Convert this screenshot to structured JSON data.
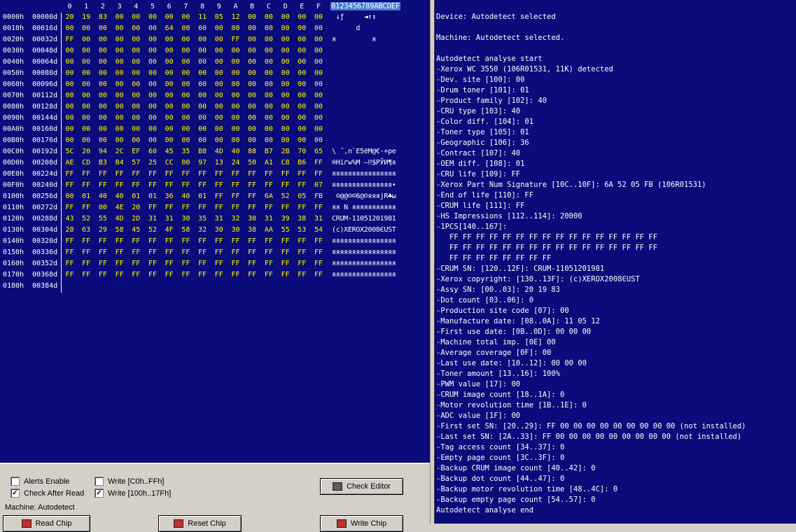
{
  "hex_view": {
    "column_headers": [
      "0",
      "1",
      "2",
      "3",
      "4",
      "5",
      "6",
      "7",
      "8",
      "9",
      "A",
      "B",
      "C",
      "D",
      "E",
      "F"
    ],
    "ascii_header": "0123456789ABCDEF",
    "rows": [
      {
        "addr": "0000h",
        "off": "00000d",
        "bytes": "20 19 83 00 00 00 00 00 11 05 12 00 00 00 00 00",
        "ascii": " ↓ƒ     ◄↑↕"
      },
      {
        "addr": "0010h",
        "off": "00016d",
        "bytes": "00 00 00 00 00 00 64 00 00 00 00 00 00 00 00 00",
        "ascii": "      d"
      },
      {
        "addr": "0020h",
        "off": "00032d",
        "bytes": "FF 00 00 00 00 00 00 00 00 00 FF 00 00 00 00 00",
        "ascii": "я         я"
      },
      {
        "addr": "0030h",
        "off": "00048d",
        "bytes": "00 00 00 00 00 00 00 00 00 00 00 00 00 00 00 00",
        "ascii": ""
      },
      {
        "addr": "0040h",
        "off": "00064d",
        "bytes": "00 00 00 00 00 00 00 00 00 00 00 00 00 00 00 00",
        "ascii": ""
      },
      {
        "addr": "0050h",
        "off": "00080d",
        "bytes": "00 00 00 00 00 00 00 00 00 00 00 00 00 00 00 00",
        "ascii": ""
      },
      {
        "addr": "0060h",
        "off": "00096d",
        "bytes": "00 00 00 00 00 00 00 00 00 00 00 00 00 00 00 00",
        "ascii": ""
      },
      {
        "addr": "0070h",
        "off": "00112d",
        "bytes": "00 00 00 00 00 00 00 00 00 00 00 00 00 00 00 00",
        "ascii": ""
      },
      {
        "addr": "0080h",
        "off": "00128d",
        "bytes": "00 00 00 00 00 00 00 00 00 00 00 00 00 00 00 00",
        "ascii": ""
      },
      {
        "addr": "0090h",
        "off": "00144d",
        "bytes": "00 00 00 00 00 00 00 00 00 00 00 00 00 00 00 00",
        "ascii": ""
      },
      {
        "addr": "00A0h",
        "off": "00160d",
        "bytes": "00 00 00 00 00 00 00 00 00 00 00 00 00 00 00 00",
        "ascii": ""
      },
      {
        "addr": "00B0h",
        "off": "00176d",
        "bytes": "00 00 00 00 00 00 00 00 00 00 00 00 00 00 00 00",
        "ascii": ""
      },
      {
        "addr": "00C0h",
        "off": "00192d",
        "bytes": "5C 20 94 2C EF 60 45 35 B8 4D 40 88 B7 2B 70 65",
        "ascii": "\\ ˝,п`E5ёM@€·+pe"
      },
      {
        "addr": "00D0h",
        "off": "00208d",
        "bytes": "AE CD B3 B4 57 25 CC 00 97 13 24 50 A1 C8 B6 FF",
        "ascii": "®Hiґw%M —‼$PЎИ¶я"
      },
      {
        "addr": "00E0h",
        "off": "00224d",
        "bytes": "FF FF FF FF FF FF FF FF FF FF FF FF FF FF FF FF",
        "ascii": "яяяяяяяяяяяяяяяя"
      },
      {
        "addr": "00F0h",
        "off": "00240d",
        "bytes": "FF FF FF FF FF FF FF FF FF FF FF FF FF FF FF 07",
        "ascii": "яяяяяяяяяяяяяяя•"
      },
      {
        "addr": "0100h",
        "off": "00256d",
        "bytes": "00 01 40 40 01 01 36 40 01 FF FF FF 6A 52 05 FB",
        "ascii": " ☺@@☺☺6@☺яяяjR♣ы"
      },
      {
        "addr": "0110h",
        "off": "00272d",
        "bytes": "FF FF 00 4E 20 FF FF FF FF FF FF FF FF FF FF FF",
        "ascii": "яя N яяяяяяяяяяя"
      },
      {
        "addr": "0120h",
        "off": "00288d",
        "bytes": "43 52 55 4D 2D 31 31 30 35 31 32 30 31 39 38 31",
        "ascii": "CRUM-11051201981"
      },
      {
        "addr": "0130h",
        "off": "00304d",
        "bytes": "28 63 29 58 45 52 4F 58 32 30 30 38 AA 55 53 54",
        "ascii": "(c)XEROX2008ЄUST"
      },
      {
        "addr": "0140h",
        "off": "00320d",
        "bytes": "FF FF FF FF FF FF FF FF FF FF FF FF FF FF FF FF",
        "ascii": "яяяяяяяяяяяяяяяя"
      },
      {
        "addr": "0150h",
        "off": "00336d",
        "bytes": "FF FF FF FF FF FF FF FF FF FF FF FF FF FF FF FF",
        "ascii": "яяяяяяяяяяяяяяяя"
      },
      {
        "addr": "0160h",
        "off": "00352d",
        "bytes": "FF FF FF FF FF FF FF FF FF FF FF FF FF FF FF FF",
        "ascii": "яяяяяяяяяяяяяяяя"
      },
      {
        "addr": "0170h",
        "off": "00368d",
        "bytes": "FF FF FF FF FF FF FF FF FF FF FF FF FF FF FF FF",
        "ascii": "яяяяяяяяяяяяяяяя"
      },
      {
        "addr": "0180h",
        "off": "00384d",
        "bytes": "",
        "ascii": ""
      }
    ]
  },
  "controls": {
    "alerts_enable": {
      "label": "Alerts Enable",
      "checked": false
    },
    "check_after_read": {
      "label": "Check After Read",
      "checked": true
    },
    "write_c0": {
      "label": "Write [C0h..FFh]",
      "checked": false
    },
    "write_100": {
      "label": "Write [100h..17Fh]",
      "checked": true
    },
    "check_editor_label": "Check Editor",
    "machine_label": "Machine: Autodetect",
    "read_chip_label": "Read Chip",
    "reset_chip_label": "Reset Chip",
    "write_chip_label": "Write Chip"
  },
  "log": [
    "Device: Autodetect selected",
    "",
    "Machine: Autodetect selected.",
    "",
    "Autodetect analyse start",
    "-Xerox WC 3550 (106R01531, 11K) detected",
    "-Dev. site [100]: 00",
    "-Drum toner [101]: 01",
    "-Product family [102]: 40",
    "-CRU type [103]: 40",
    "-Color diff. [104]: 01",
    "-Toner type [105]: 01",
    "-Geographic [106]: 36",
    "-Contract [107]: 40",
    "-OEM diff. [108]: 01",
    "-CRU life [109]: FF",
    "-Xerox Part Num Signature [10C..10F]: 6A 52 05 FB (106R01531)",
    "-End of life [110]: FF",
    "-CRUM life [111]: FF",
    "-HS Impressions [112..114]: 20000",
    "-1PCS[140..167]:",
    "   FF FF FF FF FF FF FF FF FF FF FF FF FF FF FF FF",
    "   FF FF FF FF FF FF FF FF FF FF FF FF FF FF FF FF",
    "   FF FF FF FF FF FF FF FF",
    "-CRUM SN: [120..12F]: CRUM-11051201981",
    "-Xerox copyright: [130..13F]: (c)XEROX2008ЄUST",
    "-Assy SN: [00..03]: 20 19 83",
    "-Dot count [03..06]: 0",
    "-Production site code [07]: 00",
    "-Manufacture date: [08..0A]: 11 05 12",
    "-First use date: [0B..0D]: 00 00 00",
    "-Machine total imp. [0E] 00",
    "-Average coverage [0F]: 00",
    "-Last use date: [10..12]: 00 00 00",
    "-Toner amount [13..16]: 100%",
    "-PWM value [17]: 00",
    "-CRUM image count [18..1A]: 0",
    "-Motor revolution time [1B..1E]: 0",
    "-ADC value [1F]: 00",
    "-First set SN: [20..29]: FF 00 00 00 00 00 00 00 00 00 (not installed)",
    "-Last set SN: [2A..33]: FF 00 00 00 00 00 00 00 00 00 (not installed)",
    "-Tag access count [34..37]: 0",
    "-Empty page count [3C..3F]: 0",
    "-Backup CRUM image count [40..42]: 0",
    "-Backup dot count [44..47]: 0",
    "-Backup motor revolution time [48..4C]: 0",
    "-Backup empty page count [54..57]: 0",
    "Autodetect analyse end"
  ]
}
